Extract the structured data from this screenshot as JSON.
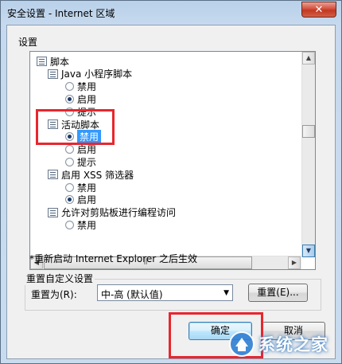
{
  "window": {
    "title": "安全设置 - Internet 区域",
    "close_label": "✕"
  },
  "settings_group_label": "设置",
  "tree": [
    {
      "type": "category",
      "level": 0,
      "label": "脚本"
    },
    {
      "type": "category",
      "level": 1,
      "label": "Java 小程序脚本"
    },
    {
      "type": "radio",
      "level": 2,
      "label": "禁用",
      "checked": false
    },
    {
      "type": "radio",
      "level": 2,
      "label": "启用",
      "checked": true
    },
    {
      "type": "radio",
      "level": 2,
      "label": "提示",
      "checked": false
    },
    {
      "type": "category",
      "level": 1,
      "label": "活动脚本"
    },
    {
      "type": "radio",
      "level": 2,
      "label": "禁用",
      "checked": true,
      "selected": true
    },
    {
      "type": "radio",
      "level": 2,
      "label": "启用",
      "checked": false
    },
    {
      "type": "radio",
      "level": 2,
      "label": "提示",
      "checked": false
    },
    {
      "type": "category",
      "level": 1,
      "label": "启用 XSS 筛选器"
    },
    {
      "type": "radio",
      "level": 2,
      "label": "禁用",
      "checked": false
    },
    {
      "type": "radio",
      "level": 2,
      "label": "启用",
      "checked": true
    },
    {
      "type": "category",
      "level": 1,
      "label": "允许对剪贴板进行编程访问"
    },
    {
      "type": "radio",
      "level": 2,
      "label": "禁用",
      "checked": false
    }
  ],
  "restart_note": "*重新启动 Internet Explorer 之后生效",
  "reset": {
    "group_label": "重置自定义设置",
    "reset_to_label": "重置为(R):",
    "selected_value": "中-高 (默认值)",
    "reset_button": "重置(E)..."
  },
  "buttons": {
    "ok": "确定",
    "cancel": "取消"
  },
  "watermark_text": "系统之家",
  "colors": {
    "highlight_red": "#e8262e",
    "selection_blue": "#3399ff"
  }
}
